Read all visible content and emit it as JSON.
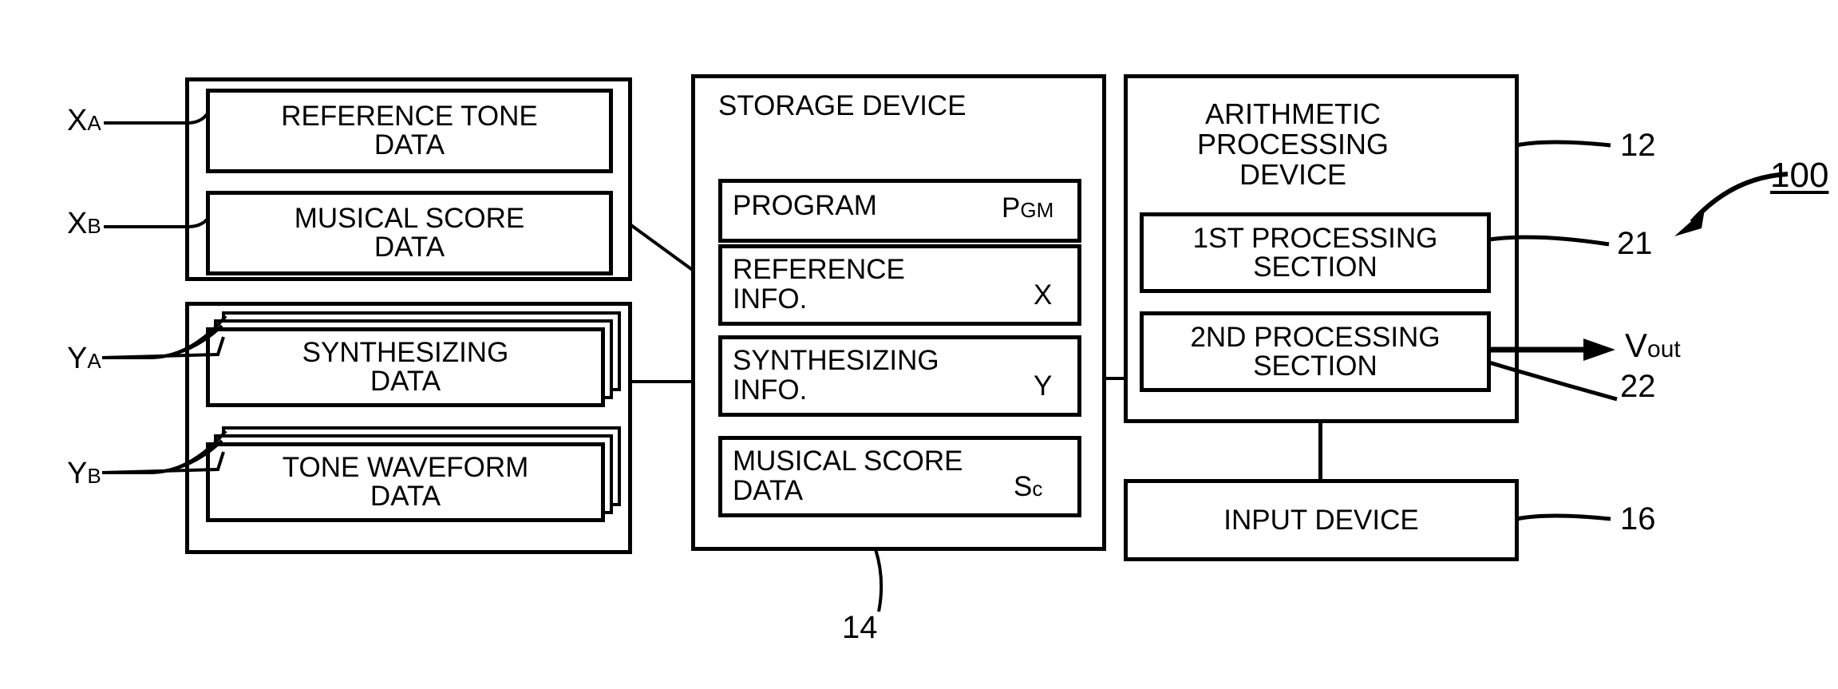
{
  "figure": {
    "type": "patent-block-diagram",
    "reference_numeral_main": "100"
  },
  "left_group_x": {
    "container_name": "input-data-group-x",
    "labels": [
      {
        "base": "X",
        "subscript": "A",
        "points_to": "reference-tone-data"
      },
      {
        "base": "X",
        "subscript": "B",
        "points_to": "musical-score-data"
      }
    ],
    "boxes": [
      {
        "text": "REFERENCE TONE\nDATA"
      },
      {
        "text": "MUSICAL SCORE\nDATA"
      }
    ]
  },
  "left_group_y": {
    "container_name": "input-data-group-y",
    "labels": [
      {
        "base": "Y",
        "subscript": "A",
        "points_to": "synthesizing-data"
      },
      {
        "base": "Y",
        "subscript": "B",
        "points_to": "tone-waveform-data"
      }
    ],
    "boxes": [
      {
        "text": "SYNTHESIZING\nDATA",
        "stacked": 3
      },
      {
        "text": "TONE WAVEFORM\nDATA",
        "stacked": 3
      }
    ]
  },
  "storage_device": {
    "title": "STORAGE DEVICE",
    "reference_numeral": "14",
    "items": [
      {
        "label": "PROGRAM",
        "symbol_main": "P",
        "symbol_sub": "GM",
        "layout": "single"
      },
      {
        "label": "REFERENCE\nINFO.",
        "symbol_main": "X",
        "symbol_sub": "",
        "layout": "two-line"
      },
      {
        "label": "SYNTHESIZING\nINFO.",
        "symbol_main": "Y",
        "symbol_sub": "",
        "layout": "two-line"
      },
      {
        "label": "MUSICAL SCORE\nDATA",
        "symbol_main": "S",
        "symbol_sub": "c",
        "layout": "two-line"
      }
    ]
  },
  "arithmetic_device": {
    "title": "ARITHMETIC\nPROCESSING\nDEVICE",
    "reference_numeral": "12",
    "sections": [
      {
        "text": "1ST PROCESSING\nSECTION",
        "reference_numeral": "21"
      },
      {
        "text": "2ND PROCESSING\nSECTION",
        "reference_numeral": "22"
      }
    ],
    "output": {
      "base": "V",
      "subscript": "out"
    }
  },
  "input_device": {
    "title": "INPUT DEVICE",
    "reference_numeral": "16"
  },
  "colors": {
    "ink": "#000000",
    "paper": "#ffffff"
  }
}
